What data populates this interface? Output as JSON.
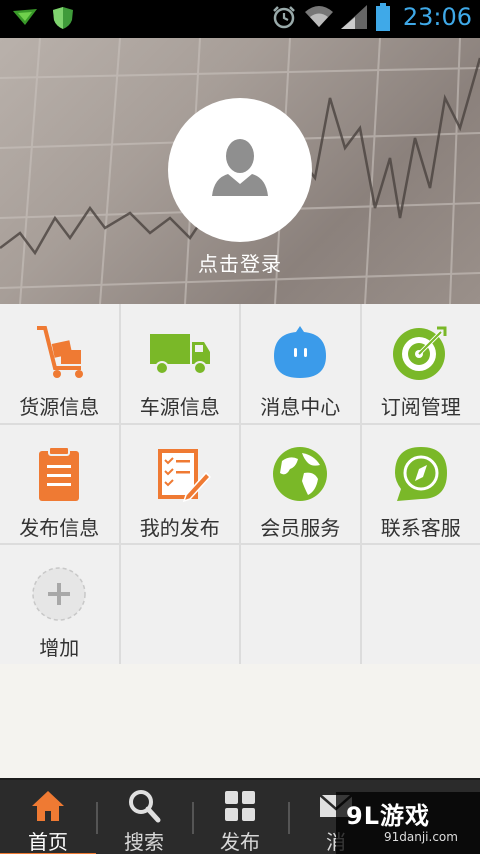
{
  "status_bar": {
    "time": "23:06"
  },
  "header": {
    "login_text": "点击登录"
  },
  "menu": {
    "items": [
      {
        "label": "货源信息",
        "icon": "cart-icon"
      },
      {
        "label": "车源信息",
        "icon": "truck-icon"
      },
      {
        "label": "消息中心",
        "icon": "chat-bubble-icon"
      },
      {
        "label": "订阅管理",
        "icon": "target-icon"
      },
      {
        "label": "发布信息",
        "icon": "clipboard-icon"
      },
      {
        "label": "我的发布",
        "icon": "checklist-icon"
      },
      {
        "label": "会员服务",
        "icon": "globe-icon"
      },
      {
        "label": "联系客服",
        "icon": "compass-icon"
      },
      {
        "label": "增加",
        "icon": "plus-icon"
      }
    ]
  },
  "nav": {
    "items": [
      {
        "label": "首页",
        "icon": "home-icon",
        "active": true
      },
      {
        "label": "搜索",
        "icon": "search-icon"
      },
      {
        "label": "发布",
        "icon": "grid-icon"
      },
      {
        "label": "消",
        "icon": "mail-icon"
      }
    ]
  },
  "watermark": {
    "main": "9L游戏",
    "sub": "91danji.com"
  },
  "colors": {
    "orange": "#ef7a33",
    "green": "#7ab828",
    "blue": "#3b9bea",
    "nav_bg": "#2b2b2b"
  }
}
